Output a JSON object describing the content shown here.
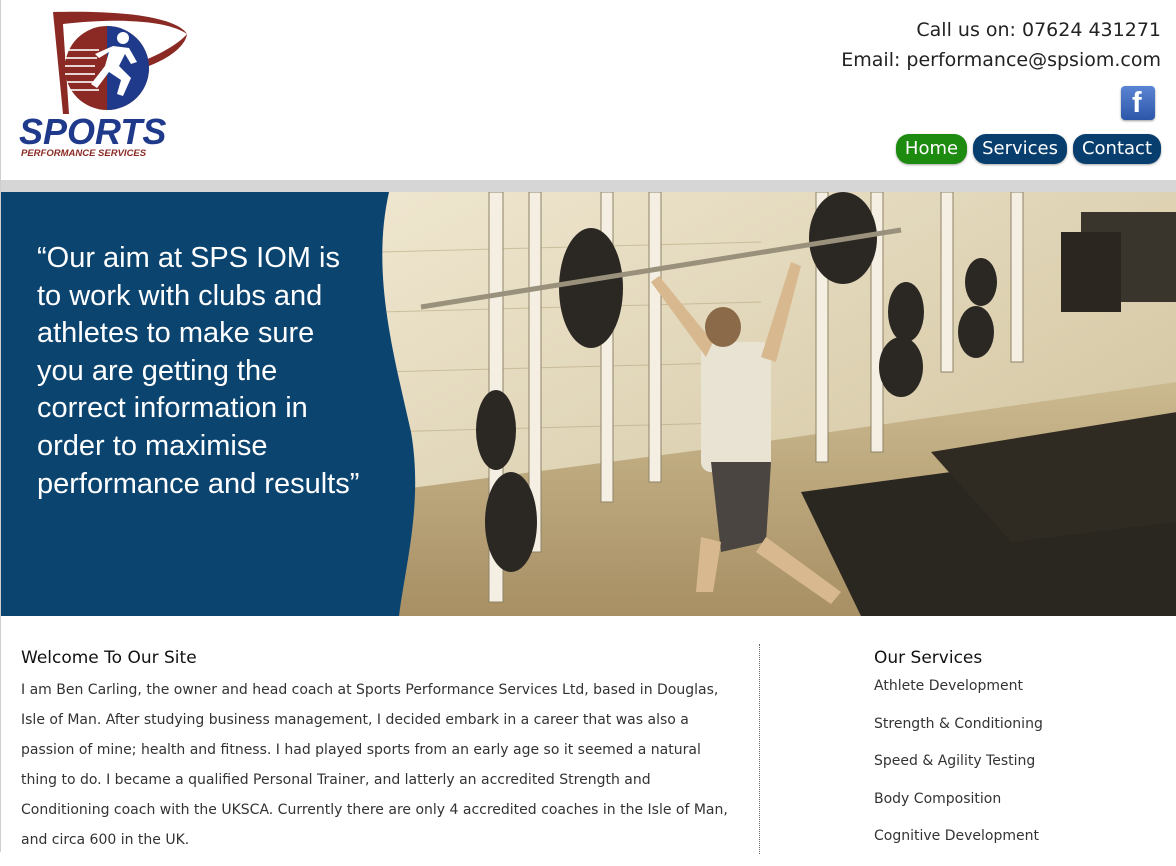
{
  "header": {
    "phone": "Call us on: 07624 431271",
    "email": "Email: performance@spsiom.com",
    "facebook_icon": "facebook-icon",
    "logo": {
      "name": "sports-performance-services-logo",
      "text_main": "SPORTS",
      "text_sub": "PERFORMANCE SERVICES"
    }
  },
  "nav": {
    "items": [
      {
        "label": "Home",
        "active": true
      },
      {
        "label": "Services",
        "active": false
      },
      {
        "label": "Contact",
        "active": false
      }
    ]
  },
  "hero": {
    "quote": "“Our aim at SPS IOM is to work with clubs and athletes to make sure you are getting the correct information in order to maximise performance and results”"
  },
  "welcome": {
    "title": "Welcome To Our Site",
    "text": "I am Ben Carling, the owner and head coach at Sports Performance Services Ltd, based in Douglas, Isle of Man. After studying business management, I decided embark in a career that was also a passion of mine; health and fitness. I had played sports from an early age so it seemed a natural thing to do. I became a qualified Personal Trainer, and latterly an accredited Strength and Conditioning coach with the UKSCA. Currently there are only 4 accredited coaches in the Isle of Man, and circa 600 in the UK."
  },
  "services": {
    "title": "Our Services",
    "items": [
      "Athlete Development",
      "Strength & Conditioning",
      "Speed & Agility Testing",
      "Body Composition",
      "Cognitive Development"
    ]
  },
  "colors": {
    "nav_active": "#1d8a10",
    "nav_default": "#073e6e",
    "hero_panel": "#0c4470",
    "logo_red": "#8b2a24",
    "logo_blue": "#1f3a8a"
  }
}
